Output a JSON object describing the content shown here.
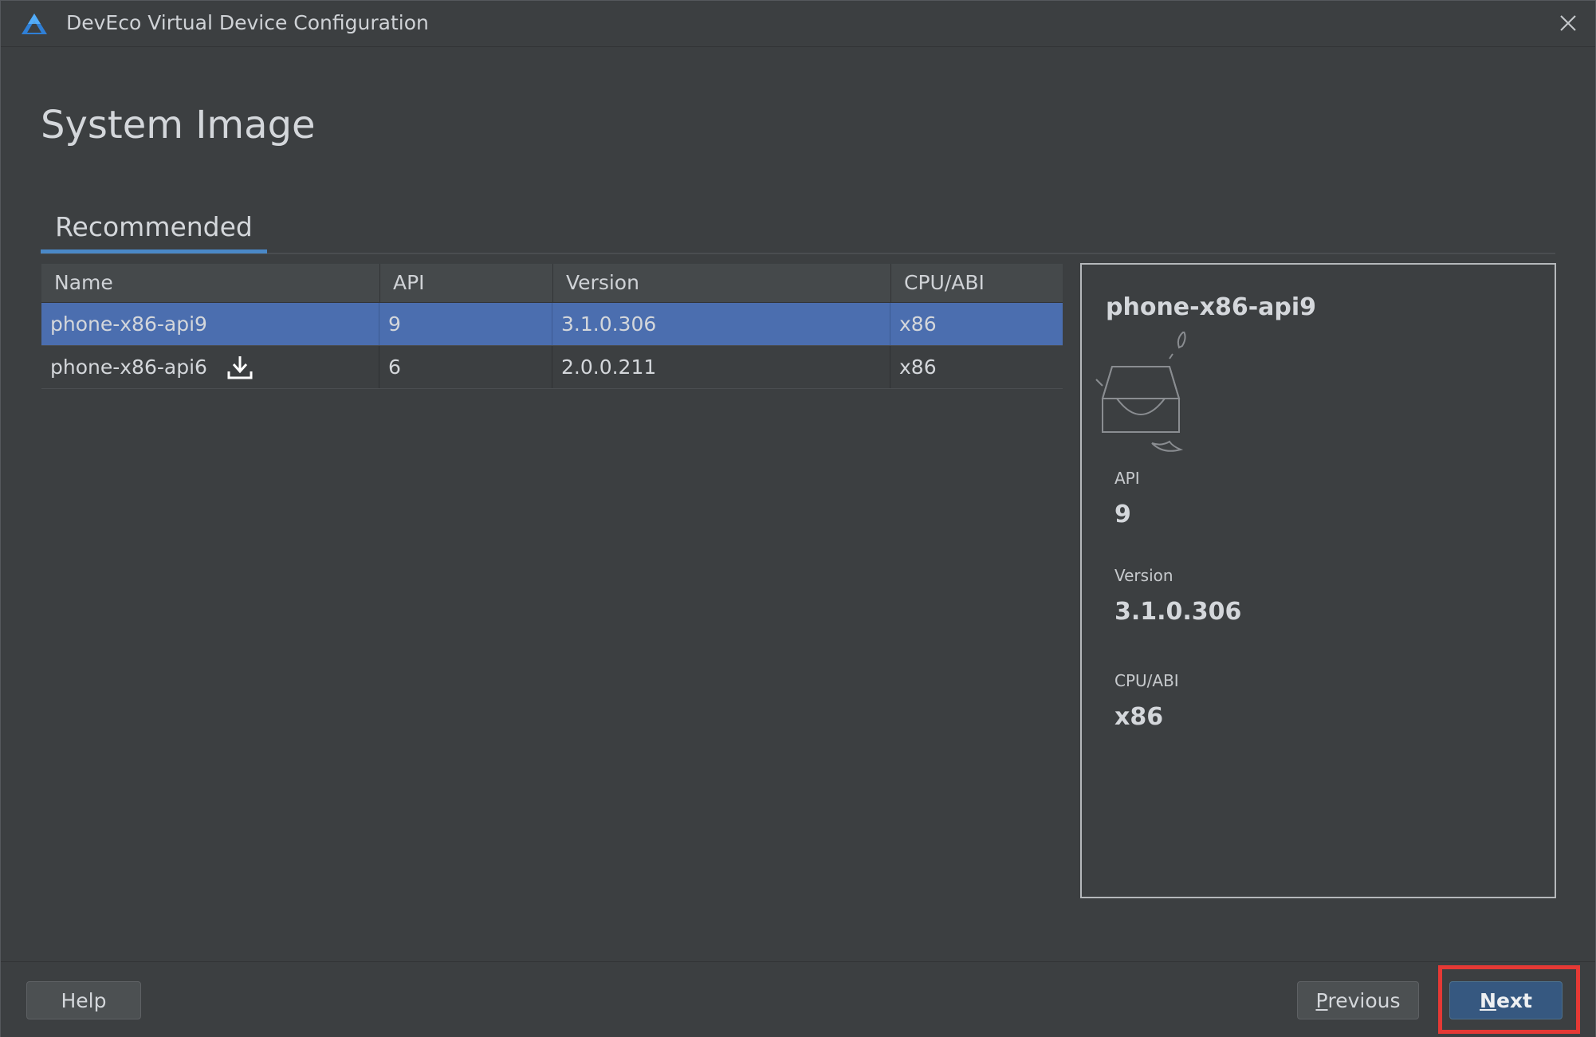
{
  "window": {
    "title": "DevEco Virtual Device Configuration"
  },
  "page": {
    "title": "System Image"
  },
  "tabs": [
    {
      "label": "Recommended",
      "active": true
    }
  ],
  "table": {
    "columns": [
      "Name",
      "API",
      "Version",
      "CPU/ABI"
    ],
    "rows": [
      {
        "name": "phone-x86-api9",
        "api": "9",
        "version": "3.1.0.306",
        "abi": "x86",
        "selected": true,
        "download": false
      },
      {
        "name": "phone-x86-api6",
        "api": "6",
        "version": "2.0.0.211",
        "abi": "x86",
        "selected": false,
        "download": true
      }
    ]
  },
  "details": {
    "name": "phone-x86-api9",
    "api_label": "API",
    "api_value": "9",
    "version_label": "Version",
    "version_value": "3.1.0.306",
    "abi_label": "CPU/ABI",
    "abi_value": "x86"
  },
  "footer": {
    "help_label": "Help",
    "previous_mnemonic": "P",
    "previous_rest": "revious",
    "next_mnemonic": "N",
    "next_rest": "ext"
  },
  "colors": {
    "selection": "#4b6eaf",
    "tab_accent": "#4a88c7",
    "highlight_box": "#e53935",
    "primary_button": "#365880"
  },
  "icons": {
    "app": "deveco-logo-icon",
    "close": "close-icon",
    "download": "download-icon",
    "illustration": "empty-tray-icon"
  }
}
